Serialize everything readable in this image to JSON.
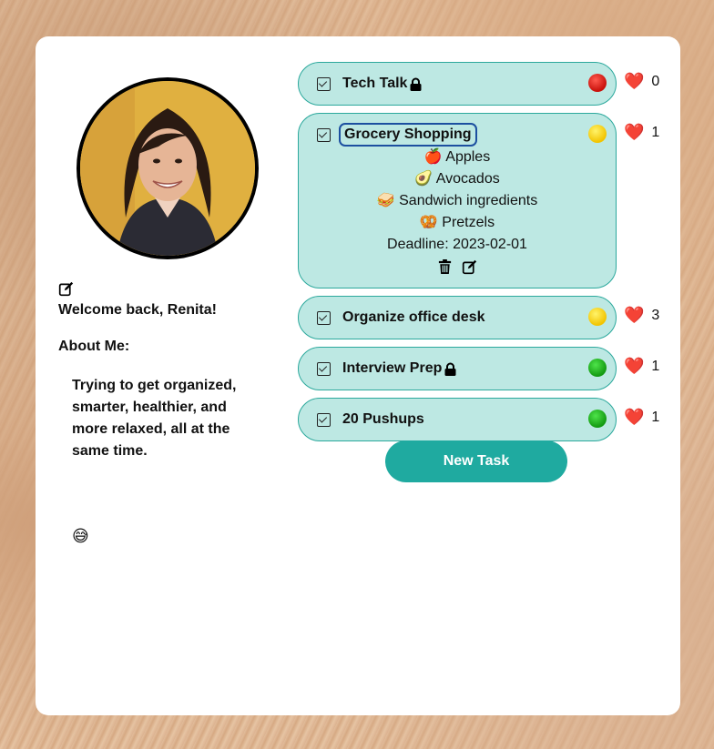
{
  "profile": {
    "welcome": "Welcome back, Renita!",
    "about_label": "About Me:",
    "about_text": "Trying to get organized, smarter, healthier, and more relaxed, all at the same time.",
    "mood_emoji": "😅"
  },
  "tasks": [
    {
      "title": "Tech Talk",
      "locked": true,
      "status_color": "red",
      "likes": "0"
    },
    {
      "title": "Grocery Shopping",
      "locked": false,
      "status_color": "yellow",
      "likes": "1",
      "expanded": true,
      "items": [
        "🍎 Apples",
        "🥑 Avocados",
        "🥪 Sandwich ingredients",
        "🥨 Pretzels"
      ],
      "deadline": "Deadline: 2023-02-01"
    },
    {
      "title": "Organize office desk",
      "locked": false,
      "status_color": "yellow",
      "likes": "3"
    },
    {
      "title": "Interview Prep",
      "locked": true,
      "status_color": "green",
      "likes": "1"
    },
    {
      "title": "20 Pushups",
      "locked": false,
      "status_color": "green",
      "likes": "1"
    }
  ],
  "heart": "❤️",
  "new_task_label": "New Task",
  "colors": {
    "task_bg": "#bde8e3",
    "task_border": "#2ba89c",
    "button": "#1faaa0"
  }
}
